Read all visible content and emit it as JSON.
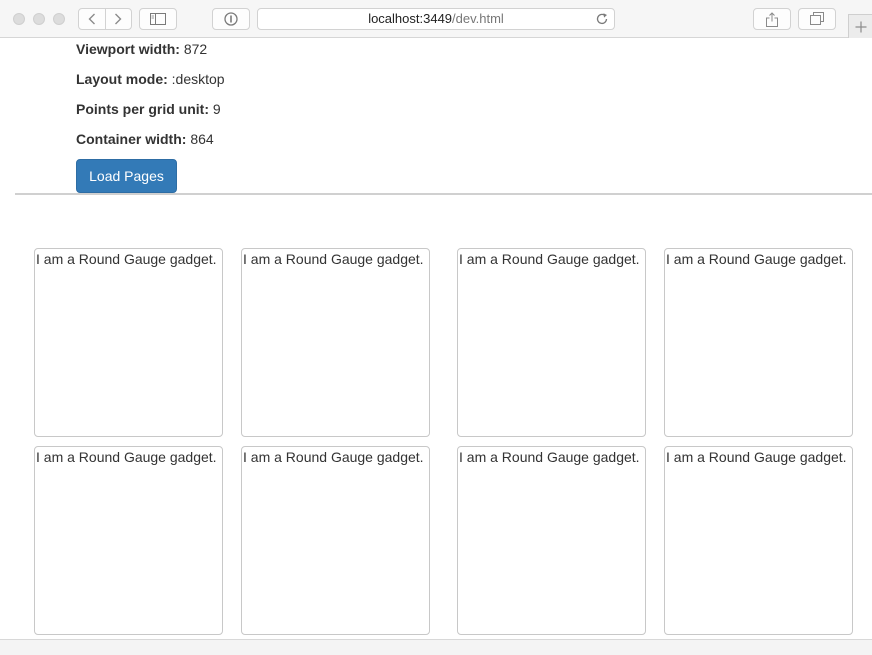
{
  "browser": {
    "url_host": "localhost:3449",
    "url_path": "/dev.html"
  },
  "info": {
    "viewport_label": "Viewport width:",
    "viewport_value": "872",
    "layout_label": "Layout mode:",
    "layout_value": ":desktop",
    "points_label": "Points per grid unit:",
    "points_value": "9",
    "container_label": "Container width:",
    "container_value": "864"
  },
  "load_button_label": "Load Pages",
  "gadgets": [
    {
      "text": "I am a Round Gauge gadget."
    },
    {
      "text": "I am a Round Gauge gadget."
    },
    {
      "text": "I am a Round Gauge gadget."
    },
    {
      "text": "I am a Round Gauge gadget."
    },
    {
      "text": "I am a Round Gauge gadget."
    },
    {
      "text": "I am a Round Gauge gadget."
    },
    {
      "text": "I am a Round Gauge gadget."
    },
    {
      "text": "I am a Round Gauge gadget."
    }
  ]
}
